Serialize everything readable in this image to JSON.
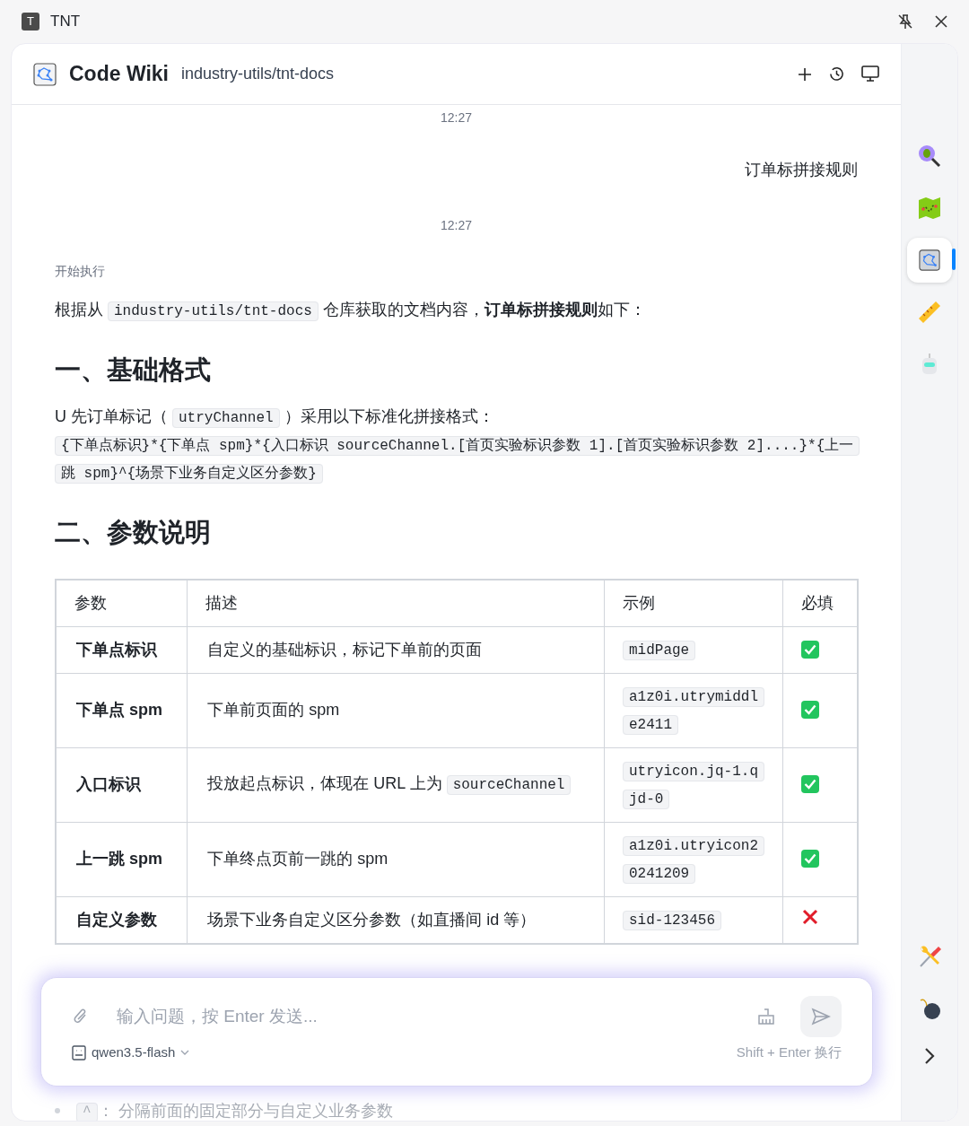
{
  "window": {
    "title": "TNT",
    "app_letter": "T"
  },
  "header": {
    "title": "Code Wiki",
    "repo": "industry-utils/tnt-docs"
  },
  "chat": [
    {
      "kind": "time",
      "text": "12:27"
    },
    {
      "kind": "user",
      "text": "订单标拼接规则"
    },
    {
      "kind": "time",
      "text": "12:27"
    },
    {
      "kind": "status",
      "text": "开始执行"
    },
    {
      "kind": "para",
      "parts": [
        {
          "kind": "text",
          "text": "根据从 "
        },
        {
          "kind": "code",
          "text": "industry-utils/tnt-docs"
        },
        {
          "kind": "text",
          "text": " 仓库获取的文档内容，"
        },
        {
          "kind": "bold",
          "text": "订单标拼接规则"
        },
        {
          "kind": "text",
          "text": "如下："
        }
      ]
    },
    {
      "kind": "heading",
      "text": "一、基础格式"
    },
    {
      "kind": "para",
      "parts": [
        {
          "kind": "text",
          "text": "U 先订单标记（ "
        },
        {
          "kind": "code",
          "text": "utryChannel"
        },
        {
          "kind": "text",
          "text": " ）采用以下标准化拼接格式："
        },
        {
          "kind": "break"
        },
        {
          "kind": "code",
          "text": "{下单点标识}*{下单点 spm}*{入口标识 sourceChannel.[首页实验标识参数 1].[首页实验标识参数 2]....}*{上一跳 spm}^{场景下业务自定义区分参数}"
        }
      ]
    },
    {
      "kind": "heading",
      "text": "二、参数说明"
    },
    {
      "kind": "table",
      "columns": [
        "参数",
        "描述",
        "示例",
        "必填"
      ],
      "rows": [
        {
          "param": "下单点标识",
          "desc": [
            {
              "kind": "text",
              "text": "自定义的基础标识，标记下单前的页面"
            }
          ],
          "example": "midPage",
          "required": true
        },
        {
          "param": "下单点 spm",
          "desc": [
            {
              "kind": "text",
              "text": "下单前页面的 spm"
            }
          ],
          "example": "a1z0i.utrymiddle2411",
          "required": true
        },
        {
          "param": "入口标识",
          "desc": [
            {
              "kind": "text",
              "text": "投放起点标识，体现在 URL 上为 "
            },
            {
              "kind": "code",
              "text": "sourceChannel"
            }
          ],
          "example": "utryicon.jq-1.qjd-0",
          "required": true
        },
        {
          "param": "上一跳 spm",
          "desc": [
            {
              "kind": "text",
              "text": "下单终点页前一跳的 spm"
            }
          ],
          "example": "a1z0i.utryicon20241209",
          "required": true
        },
        {
          "param": "自定义参数",
          "desc": [
            {
              "kind": "text",
              "text": "场景下业务自定义区分参数（如直播间 id 等）"
            }
          ],
          "example": "sid-123456",
          "required": false
        }
      ]
    },
    {
      "kind": "bullet",
      "parts": [
        {
          "kind": "code",
          "text": "^"
        },
        {
          "kind": "text",
          "text": "： 分隔前面的固定部分与自定义业务参数"
        }
      ]
    }
  ],
  "input": {
    "placeholder": "输入问题，按 Enter 发送...",
    "model": "qwen3.5-flash",
    "hint": "Shift + Enter 换行"
  },
  "sidebar": [
    {
      "kind": "bug",
      "selected": false
    },
    {
      "kind": "map",
      "selected": false
    },
    {
      "kind": "graph",
      "selected": true
    },
    {
      "kind": "ruler",
      "selected": false
    },
    {
      "kind": "robot",
      "selected": false
    },
    {
      "kind": "tools",
      "selected": false
    },
    {
      "kind": "bomb",
      "selected": false
    }
  ]
}
